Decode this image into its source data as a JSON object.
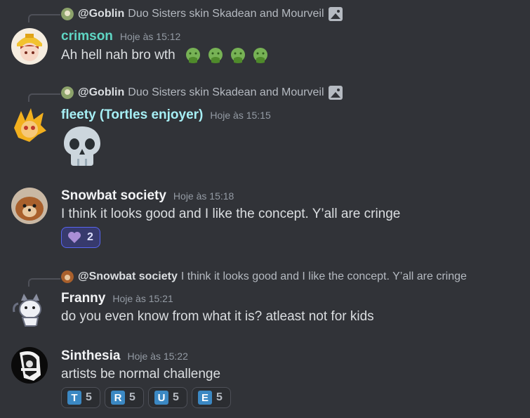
{
  "messages": [
    {
      "reply": {
        "name": "@Goblin",
        "text": "Duo Sisters skin Skadean and Mourveil"
      },
      "author": "crimson",
      "author_color": "#5fd6c4",
      "timestamp": "Hoje às 15:12",
      "text": "Ah hell nah bro wth",
      "emojis": [
        "nauseated-face",
        "nauseated-face",
        "nauseated-face",
        "nauseated-face"
      ]
    },
    {
      "reply": {
        "name": "@Goblin",
        "text": "Duo Sisters skin Skadean and Mourveil"
      },
      "author": "fleety (Tortles enjoyer)",
      "author_color": "#a6eff5",
      "timestamp": "Hoje às 15:15",
      "emoji": "skull"
    },
    {
      "author": "Snowbat society",
      "author_color": "#f2f3f5",
      "timestamp": "Hoje às 15:18",
      "text": "I think it looks good and I like the concept. Y’all are cringe",
      "reactions": [
        {
          "emoji": "purple-heart",
          "count": "2"
        }
      ]
    },
    {
      "reply": {
        "name": "@Snowbat society",
        "text": "I think it looks good and I like the concept. Y’all are cringe"
      },
      "author": "Franny",
      "author_color": "#f2f3f5",
      "timestamp": "Hoje às 15:21",
      "text": "do you even know from what it is? atleast not for kids"
    },
    {
      "author": "Sinthesia",
      "author_color": "#f2f3f5",
      "timestamp": "Hoje às 15:22",
      "text": "artists be normal challenge",
      "reactions": [
        {
          "letter": "T",
          "count": "5"
        },
        {
          "letter": "R",
          "count": "5"
        },
        {
          "letter": "U",
          "count": "5"
        },
        {
          "letter": "E",
          "count": "5"
        }
      ]
    }
  ]
}
